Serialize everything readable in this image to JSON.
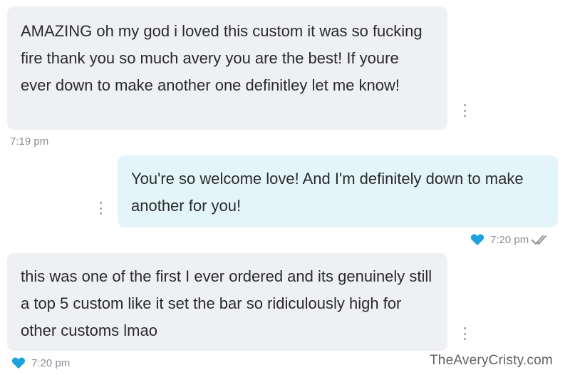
{
  "messages": [
    {
      "direction": "incoming",
      "text": "AMAZING oh my god i loved this custom it was so fucking fire thank you so much avery you are the best! If youre ever down to make another one definitley let me know!",
      "time": "7:19 pm",
      "liked": false
    },
    {
      "direction": "outgoing",
      "text": "You're so welcome love! And I'm definitely down to make another for you!",
      "time": "7:20 pm",
      "liked": true,
      "read_receipt": "double-check"
    },
    {
      "direction": "incoming",
      "text": "this was one of the first I ever ordered and its genuinely still a top 5 custom like it set the bar so ridiculously high for other customs lmao",
      "time": "7:20 pm",
      "liked": true
    }
  ],
  "watermark": "TheAveryCristy.com",
  "colors": {
    "incoming_bubble": "#eef0f3",
    "outgoing_bubble": "#e3f5fb",
    "heart": "#1aa3dd",
    "timestamp": "#8a8f94"
  },
  "icons": {
    "message_menu": "vertical-dots-icon",
    "like": "heart-icon",
    "read": "double-check-icon"
  }
}
